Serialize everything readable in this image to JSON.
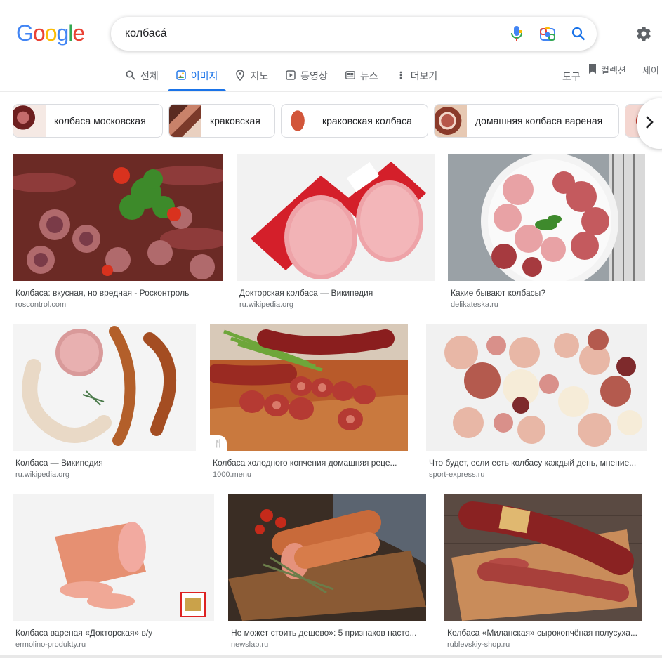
{
  "logo": {
    "letters": [
      "G",
      "o",
      "o",
      "g",
      "l",
      "e"
    ]
  },
  "search": {
    "value": "колбаса́"
  },
  "tabs": [
    {
      "label": "전체",
      "icon": "search-icon"
    },
    {
      "label": "이미지",
      "icon": "image-icon",
      "active": true
    },
    {
      "label": "지도",
      "icon": "map-pin-icon"
    },
    {
      "label": "동영상",
      "icon": "video-icon"
    },
    {
      "label": "뉴스",
      "icon": "news-icon"
    },
    {
      "label": "더보기",
      "icon": "more-icon"
    }
  ],
  "tools_label": "도구",
  "collection_label": "컬렉션",
  "safe_label": "세이",
  "chips": [
    {
      "label": "колбаса московская",
      "color": "#7a2a2a"
    },
    {
      "label": "краковская",
      "color": "#8a3b2c"
    },
    {
      "label": "краковская колбаса",
      "color": "#c6533a"
    },
    {
      "label": "домашняя колбаса вареная",
      "color": "#9b4a3a"
    }
  ],
  "results": [
    {
      "title": "Колбаса: вкусная, но вредная - Росконтроль",
      "source": "roscontrol.com"
    },
    {
      "title": "Докторская колбаса — Википедия",
      "source": "ru.wikipedia.org"
    },
    {
      "title": "Какие бывают колбасы?",
      "source": "delikateska.ru"
    },
    {
      "title": "Колбаса — Википедия",
      "source": "ru.wikipedia.org"
    },
    {
      "title": "Колбаса холодного копчения домашняя реце...",
      "source": "1000.menu"
    },
    {
      "title": "Что будет, если есть колбасу каждый день, мнение...",
      "source": "sport-express.ru"
    },
    {
      "title": "Колбаса вареная «Докторская» в/у",
      "source": "ermolino-produkty.ru"
    },
    {
      "title": "Не может стоить дешево»: 5 признаков насто...",
      "source": "newslab.ru"
    },
    {
      "title": "Колбаса «Миланская» сырокопчёная полусуха...",
      "source": "rublevskiy-shop.ru"
    }
  ],
  "colors": {
    "accent": "#1a73e8",
    "muted": "#5f6368"
  }
}
